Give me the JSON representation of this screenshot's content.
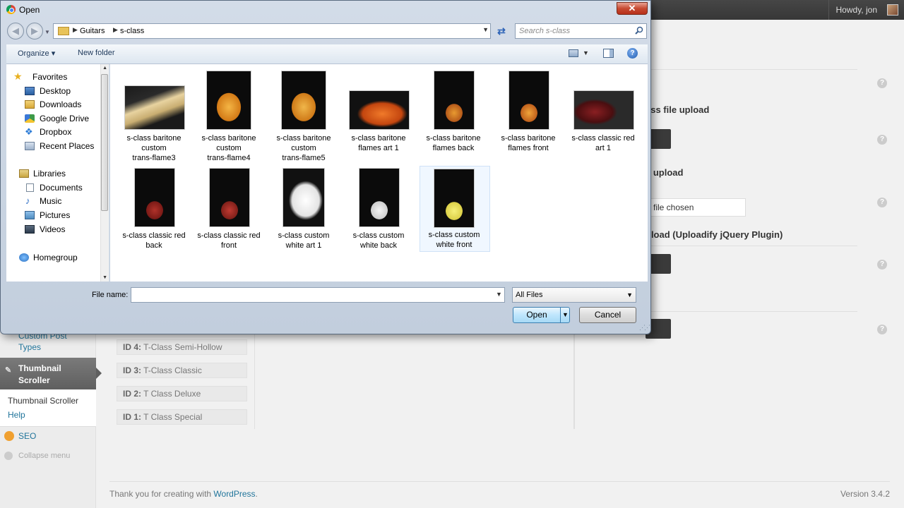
{
  "wp": {
    "howdy": "Howdy, jon",
    "sidebar": {
      "custom_post_types_1": "Custom Post",
      "custom_post_types_2": "Types",
      "thumbnail_scroller_1": "Thumbnail",
      "thumbnail_scroller_2": "Scroller",
      "submenu_thumbnail_scroller": "Thumbnail Scroller",
      "submenu_help": "Help",
      "seo": "SEO",
      "collapse": "Collapse menu"
    },
    "id_items": [
      {
        "id": "ID 4:",
        "name": "T-Class Semi-Hollow"
      },
      {
        "id": "ID 3:",
        "name": "T-Class Classic"
      },
      {
        "id": "ID 2:",
        "name": "T Class Deluxe"
      },
      {
        "id": "ID 1:",
        "name": "T Class Special"
      }
    ],
    "right": {
      "section1": "ess file upload",
      "section2": "e upload",
      "file_chosen": "file chosen",
      "section3": "pload (Uploadify jQuery Plugin)"
    },
    "footer": {
      "prefix": "Thank you for creating with ",
      "link": "WordPress",
      "suffix": ".",
      "version": "Version 3.4.2"
    }
  },
  "dialog": {
    "title": "Open",
    "close": "✕",
    "breadcrumb": [
      "Guitars",
      "s-class"
    ],
    "search_placeholder": "Search s-class",
    "toolbar": {
      "organize": "Organize ▾",
      "new_folder": "New folder"
    },
    "nav": {
      "favorites": "Favorites",
      "desktop": "Desktop",
      "downloads": "Downloads",
      "google_drive": "Google Drive",
      "dropbox": "Dropbox",
      "recent_places": "Recent Places",
      "libraries": "Libraries",
      "documents": "Documents",
      "music": "Music",
      "pictures": "Pictures",
      "videos": "Videos",
      "homegroup": "Homegroup"
    },
    "files": [
      {
        "line1": "s-class baritone",
        "line2": "custom",
        "line3": "trans-flame3"
      },
      {
        "line1": "s-class baritone",
        "line2": "custom",
        "line3": "trans-flame4"
      },
      {
        "line1": "s-class baritone",
        "line2": "custom",
        "line3": "trans-flame5"
      },
      {
        "line1": "s-class baritone",
        "line2": "flames art 1",
        "line3": ""
      },
      {
        "line1": "s-class baritone",
        "line2": "flames back",
        "line3": ""
      },
      {
        "line1": "s-class baritone",
        "line2": "flames front",
        "line3": ""
      },
      {
        "line1": "s-class classic red",
        "line2": "art 1",
        "line3": ""
      },
      {
        "line1": "s-class classic red",
        "line2": "back",
        "line3": ""
      },
      {
        "line1": "s-class classic red",
        "line2": "front",
        "line3": ""
      },
      {
        "line1": "s-class custom",
        "line2": "white art 1",
        "line3": ""
      },
      {
        "line1": "s-class custom",
        "line2": "white back",
        "line3": ""
      },
      {
        "line1": "s-class custom",
        "line2": "white front",
        "line3": ""
      }
    ],
    "file_name_label": "File name:",
    "file_name_value": "",
    "file_type": "All Files",
    "open_button": "Open",
    "cancel_button": "Cancel"
  }
}
